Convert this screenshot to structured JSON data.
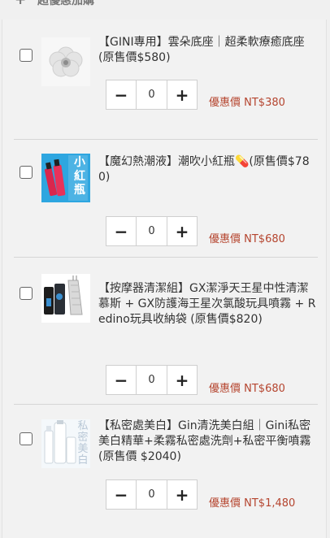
{
  "section": {
    "title": "超優惠加購",
    "expand_icon": "+"
  },
  "items": [
    {
      "name": "【GINI專用】雲朵底座｜超柔軟療癒底座(原售價$580)",
      "qty": "0",
      "price": "優惠價 NT$380",
      "thumb_icon": "cloud-base-image"
    },
    {
      "name": "【魔幻熱潮液】潮吹小紅瓶💊(原售價$780)",
      "qty": "0",
      "price": "優惠價 NT$680",
      "thumb_icon": "red-bottle-image",
      "thumb_text": "小紅瓶"
    },
    {
      "name": "【按摩器清潔組】GX潔淨天王星中性清潔慕斯 + GX防護海王星次氯酸玩具噴霧 + Redino玩具收納袋 (原售價$820)",
      "qty": "0",
      "price": "優惠價 NT$680",
      "thumb_icon": "cleaning-set-image"
    },
    {
      "name": "【私密處美白】Gin清洗美白組｜Gini私密美白精華+柔霧私密處洗劑+私密平衡噴霧(原售價 $2040)",
      "qty": "0",
      "price": "優惠價 NT$1,480",
      "thumb_icon": "whitening-set-image",
      "thumb_text": "私密美白"
    }
  ],
  "stepper": {
    "minus": "−",
    "plus": "+"
  }
}
